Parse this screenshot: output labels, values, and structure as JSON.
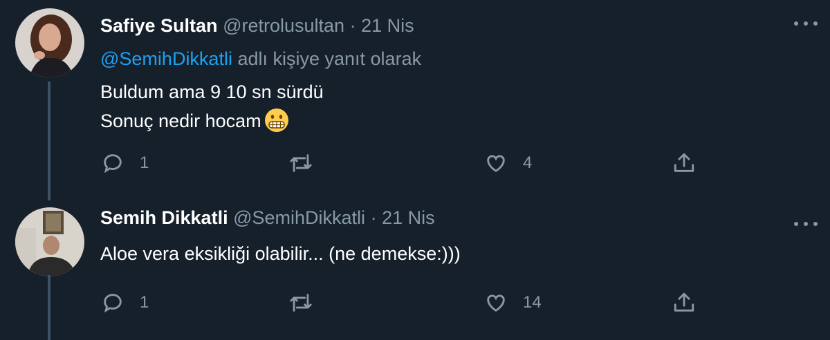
{
  "tweets": [
    {
      "name": "Safiye Sultan",
      "handle": "@retrolusultan",
      "separator": "·",
      "date": "21 Nis",
      "replying_mention": "@SemihDikkatli",
      "replying_suffix": " adlı kişiye yanıt olarak",
      "lines": [
        "Buldum ama 9 10 sn sürdü",
        "Sonuç nedir hocam"
      ],
      "emoji": "grimacing-face",
      "reply_count": "1",
      "retweet_count": "",
      "like_count": "4"
    },
    {
      "name": "Semih Dikkatli",
      "handle": "@SemihDikkatli",
      "separator": "·",
      "date": "21 Nis",
      "lines": [
        "Aloe vera eksikliği olabilir... (ne demekse:)))"
      ],
      "reply_count": "1",
      "retweet_count": "",
      "like_count": "14"
    }
  ],
  "colors": {
    "background": "#15202b",
    "text": "#ffffff",
    "secondary": "#8899a6",
    "mention": "#1da1f2",
    "thread_line": "#3d5466"
  },
  "icons": [
    "reply-icon",
    "retweet-icon",
    "like-icon",
    "share-icon",
    "more-icon"
  ]
}
